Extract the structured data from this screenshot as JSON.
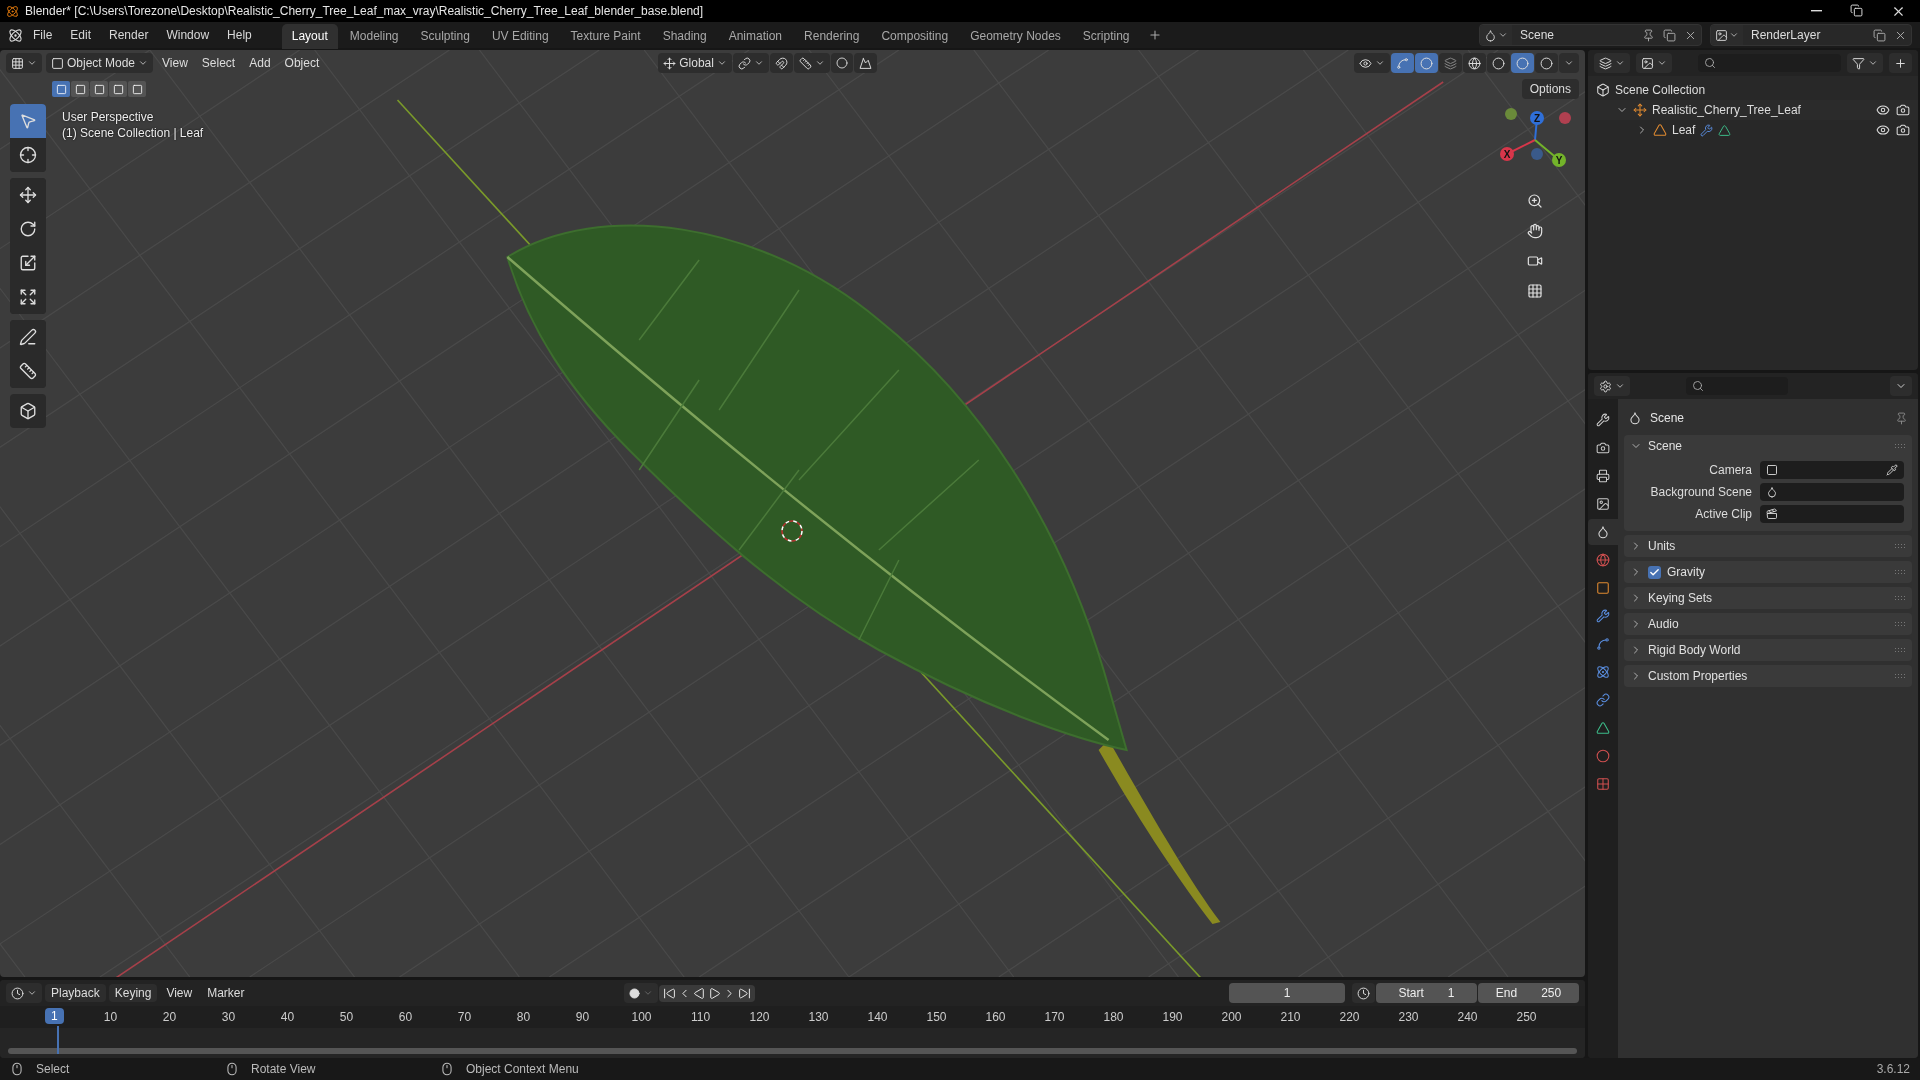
{
  "window": {
    "title": "Blender* [C:\\Users\\Torezone\\Desktop\\Realistic_Cherry_Tree_Leaf_max_vray\\Realistic_Cherry_Tree_Leaf_blender_base.blend]"
  },
  "menu": [
    "File",
    "Edit",
    "Render",
    "Window",
    "Help"
  ],
  "workspaces": [
    {
      "label": "Layout",
      "selected": true
    },
    {
      "label": "Modeling",
      "selected": false
    },
    {
      "label": "Sculpting",
      "selected": false
    },
    {
      "label": "UV Editing",
      "selected": false
    },
    {
      "label": "Texture Paint",
      "selected": false
    },
    {
      "label": "Shading",
      "selected": false
    },
    {
      "label": "Animation",
      "selected": false
    },
    {
      "label": "Rendering",
      "selected": false
    },
    {
      "label": "Compositing",
      "selected": false
    },
    {
      "label": "Geometry Nodes",
      "selected": false
    },
    {
      "label": "Scripting",
      "selected": false
    }
  ],
  "scene": {
    "value": "Scene"
  },
  "view_layer": {
    "value": "RenderLayer"
  },
  "viewport": {
    "mode": "Object Mode",
    "menus": [
      "View",
      "Select",
      "Add",
      "Object"
    ],
    "orientation": "Global",
    "options": "Options",
    "toggles": [
      {
        "selected": true
      },
      {
        "selected": true
      }
    ],
    "shading": [
      {
        "selected": false
      },
      {
        "selected": false
      },
      {
        "selected": true
      },
      {
        "selected": false
      }
    ],
    "select_modes": [
      {
        "selected": true
      },
      {
        "selected": false
      },
      {
        "selected": false
      },
      {
        "selected": false
      },
      {
        "selected": false
      }
    ],
    "info": [
      "User Perspective",
      "(1) Scene Collection | Leaf"
    ],
    "tools": [
      {
        "selected": true
      },
      {
        "selected": false
      },
      {
        "selected": false
      },
      {
        "selected": false
      },
      {
        "selected": false
      },
      {
        "selected": false
      },
      {
        "selected": false
      },
      {
        "selected": false
      },
      {
        "selected": false
      }
    ],
    "gizmo_labels": [
      "Z",
      "X",
      "Y"
    ]
  },
  "outliner": {
    "tree": [
      {
        "label": "Scene Collection",
        "kind": "collection",
        "children": [
          {
            "label": "Realistic_Cherry_Tree_Leaf",
            "kind": "empty",
            "expanded": true,
            "children": [
              {
                "label": "Leaf",
                "kind": "mesh",
                "expanded": false
              }
            ]
          }
        ]
      }
    ]
  },
  "properties": {
    "tabs": [
      {
        "selected": false
      },
      {
        "selected": false
      },
      {
        "selected": false
      },
      {
        "selected": false
      },
      {
        "selected": true
      },
      {
        "selected": false
      },
      {
        "selected": false
      },
      {
        "selected": false
      },
      {
        "selected": false
      },
      {
        "selected": false
      },
      {
        "selected": false
      },
      {
        "selected": false
      },
      {
        "selected": false
      },
      {
        "selected": false
      }
    ],
    "context": "Scene",
    "panels": [
      {
        "title": "Scene",
        "kind": "plain",
        "expanded": true,
        "fields": [
          {
            "label": "Camera"
          },
          {
            "label": "Background Scene"
          },
          {
            "label": "Active Clip"
          }
        ]
      },
      {
        "title": "Units",
        "kind": "plain",
        "expanded": false
      },
      {
        "title": "Gravity",
        "kind": "toggle",
        "expanded": false,
        "checked": true
      },
      {
        "title": "Keying Sets",
        "kind": "plain",
        "expanded": false
      },
      {
        "title": "Audio",
        "kind": "plain",
        "expanded": false
      },
      {
        "title": "Rigid Body World",
        "kind": "plain",
        "expanded": false
      },
      {
        "title": "Custom Properties",
        "kind": "plain",
        "expanded": false
      }
    ]
  },
  "timeline": {
    "menus": [
      "Playback",
      "Keying",
      "View",
      "Marker"
    ],
    "current_frame": "1",
    "start": {
      "label": "Start",
      "value": "1"
    },
    "end": {
      "label": "End",
      "value": "250"
    },
    "playhead": "1",
    "ruler": [
      "10",
      "20",
      "30",
      "40",
      "50",
      "60",
      "70",
      "80",
      "90",
      "100",
      "110",
      "120",
      "130",
      "140",
      "150",
      "160",
      "170",
      "180",
      "190",
      "200",
      "210",
      "220",
      "230",
      "240",
      "250"
    ]
  },
  "status_bar": {
    "hints": [
      "Select",
      "Rotate View",
      "Object Context Menu"
    ],
    "version": "3.6.12"
  }
}
